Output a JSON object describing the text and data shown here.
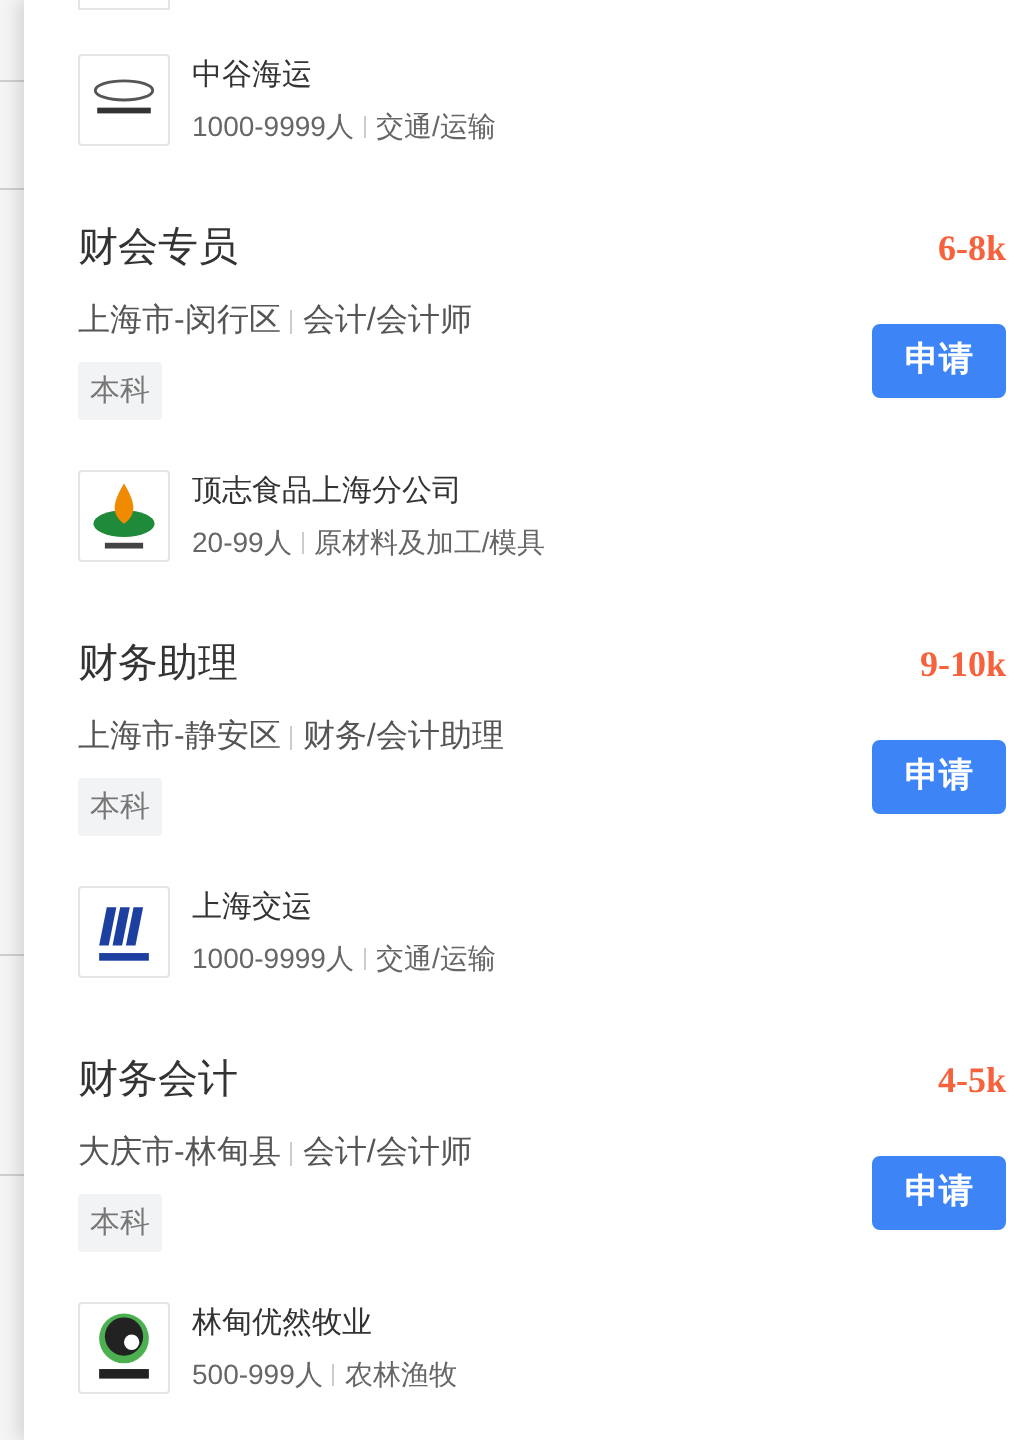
{
  "top_company": {
    "name": "中谷海运",
    "size": "1000-9999人",
    "industry": "交通/运输",
    "kind": "swoosh"
  },
  "jobs": [
    {
      "title": "财会专员",
      "salary": "6-8k",
      "location": "上海市-闵行区",
      "category": "会计/会计师",
      "education": "本科",
      "button": "申请",
      "company": {
        "name": "顶志食品上海分公司",
        "size": "20-99人",
        "industry": "原材料及加工/模具",
        "kind": "drop"
      }
    },
    {
      "title": "财务助理",
      "salary": "9-10k",
      "location": "上海市-静安区",
      "category": "财务/会计助理",
      "education": "本科",
      "button": "申请",
      "company": {
        "name": "上海交运",
        "size": "1000-9999人",
        "industry": "交通/运输",
        "kind": "stripes"
      }
    },
    {
      "title": "财务会计",
      "salary": "4-5k",
      "location": "大庆市-林甸县",
      "category": "会计/会计师",
      "education": "本科",
      "button": "申请",
      "company": {
        "name": "林甸优然牧业",
        "size": "500-999人",
        "industry": "农林渔牧",
        "kind": "cow"
      }
    }
  ]
}
